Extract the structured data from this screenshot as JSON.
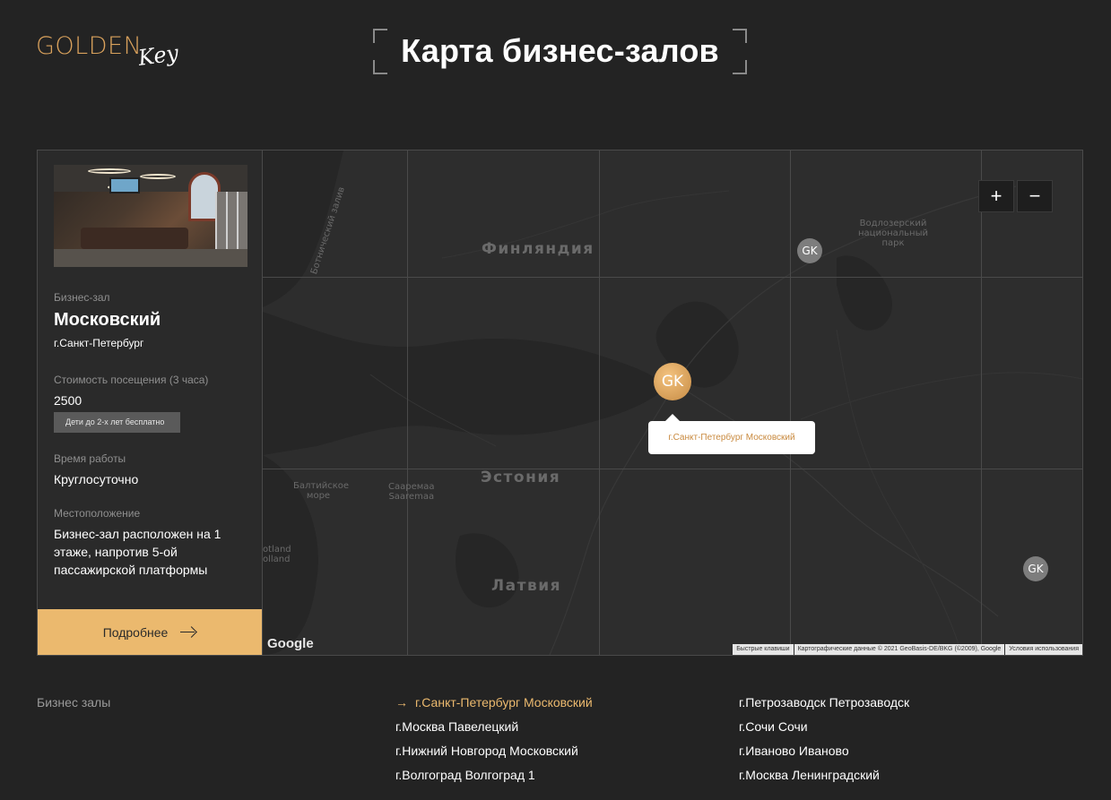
{
  "header": {
    "logo_main": "GOLDEN",
    "logo_script": "Key",
    "title": "Карта бизнес-залов"
  },
  "info_panel": {
    "type_label": "Бизнес-зал",
    "hall_name": "Московский",
    "city": "г.Санкт-Петербург",
    "price_label": "Стоимость посещения (3 часа)",
    "price_value": "2500",
    "kids_badge": "Дети до 2-х лет бесплатно",
    "hours_label": "Время работы",
    "hours_value": "Круглосуточно",
    "location_label": "Местоположение",
    "location_value": "Бизнес-зал расположен на 1 этаже, напротив 5-ой пассажирской платформы",
    "more_button": "Подробнее"
  },
  "map": {
    "zoom_in": "+",
    "zoom_out": "−",
    "labels": {
      "finland": "Финляндия",
      "estonia": "Эстония",
      "latvia": "Латвия",
      "bothnian": "Ботнический залив",
      "baltic": "Балтийское море",
      "saaremaa_1": "Сааремаа",
      "saaremaa_2": "Saaremaa",
      "vodlozersky_1": "Водлозерский",
      "vodlozersky_2": "национальный",
      "vodlozersky_3": "парк",
      "gotland_1": "otland",
      "gotland_2": "olland"
    },
    "marker_text": "GK",
    "popup_text": "г.Санкт-Петербург Московский",
    "google_logo": "Google",
    "attrib": {
      "shortcuts": "Быстрые клавиши",
      "data": "Картографические данные © 2021 GeoBasis-DE/BKG (©2009), Google",
      "terms": "Условия использования"
    }
  },
  "hall_list": {
    "heading": "Бизнес залы",
    "arrow": "→",
    "col1": [
      "г.Санкт-Петербург Московский",
      "г.Москва Павелецкий",
      "г.Нижний Новгород Московский",
      "г.Волгоград Волгоград 1"
    ],
    "col2": [
      "г.Петрозаводск Петрозаводск",
      "г.Сочи Сочи",
      "г.Иваново Иваново",
      "г.Москва Ленинградский"
    ]
  },
  "colors": {
    "accent": "#ebb96e",
    "logo_gold": "#d9a15c",
    "background": "#232323",
    "panel": "#2a2a2a"
  }
}
